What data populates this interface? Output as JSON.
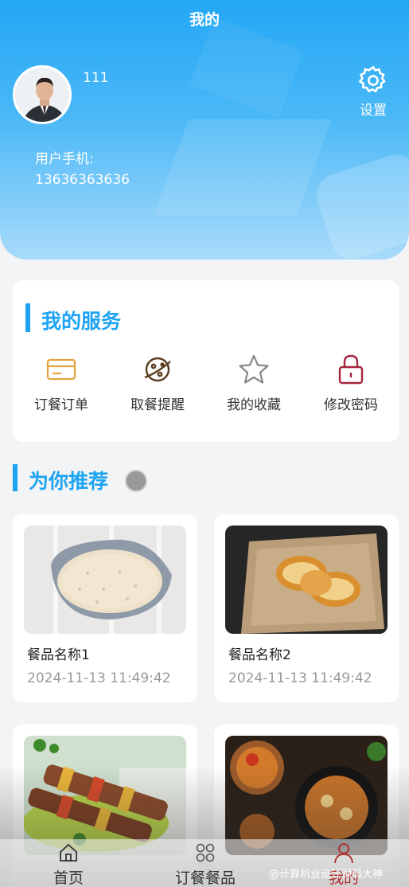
{
  "header": {
    "title": "我的"
  },
  "user": {
    "name": "111",
    "phone_label": "用户手机:",
    "phone": "13636363636"
  },
  "settings": {
    "label": "设置",
    "icon": "gear-icon"
  },
  "services": {
    "title": "我的服务",
    "items": [
      {
        "label": "订餐订单",
        "icon": "card-icon",
        "color": "#e6a23c"
      },
      {
        "label": "取餐提醒",
        "icon": "planet-icon",
        "color": "#5a3b1e"
      },
      {
        "label": "我的收藏",
        "icon": "star-icon",
        "color": "#888888"
      },
      {
        "label": "修改密码",
        "icon": "lock-icon",
        "color": "#a6263e"
      }
    ]
  },
  "recommend": {
    "title": "为你推荐",
    "items": [
      {
        "name": "餐品名称1",
        "time": "2024-11-13 11:49:42"
      },
      {
        "name": "餐品名称2",
        "time": "2024-11-13 11:49:42"
      },
      {
        "name": "",
        "time": ""
      },
      {
        "name": "",
        "time": ""
      }
    ]
  },
  "tabbar": {
    "items": [
      {
        "label": "首页",
        "icon": "home-icon"
      },
      {
        "label": "订餐餐品",
        "icon": "grid-icon"
      },
      {
        "label": "我的",
        "icon": "user-icon",
        "active": true
      }
    ]
  },
  "watermark": "@计算机业设计源码大神",
  "colors": {
    "accent": "#1ea4f3",
    "header_top": "#23a7f5",
    "active_tab": "#b22a2a"
  }
}
